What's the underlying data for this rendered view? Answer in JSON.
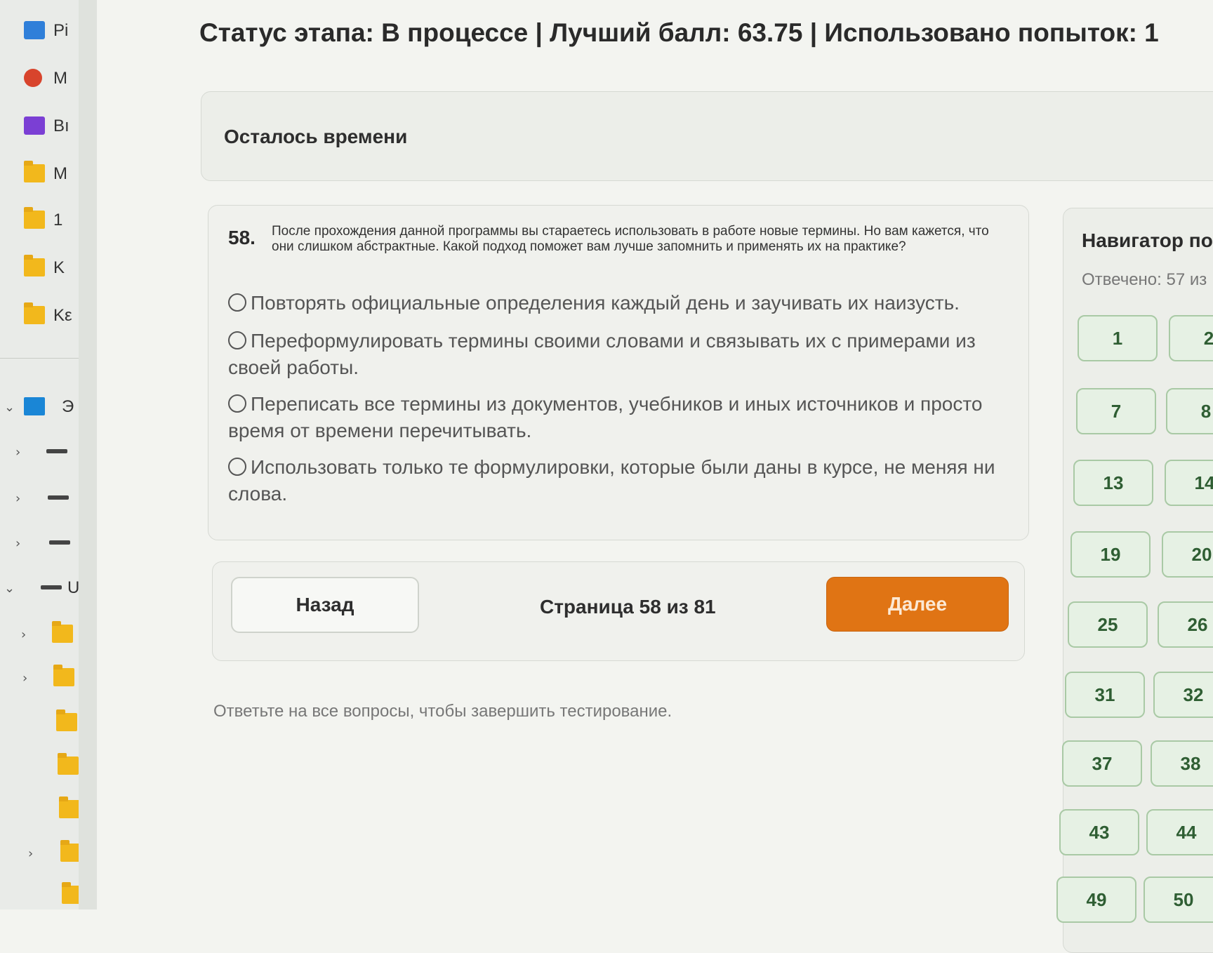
{
  "explorer": {
    "items": [
      {
        "label": "Pi",
        "icon": "pictures-icon"
      },
      {
        "label": "M",
        "icon": "music-icon"
      },
      {
        "label": "Bı",
        "icon": "video-icon"
      },
      {
        "label": "M",
        "icon": "folder-icon"
      },
      {
        "label": "1",
        "icon": "folder-icon"
      },
      {
        "label": "K",
        "icon": "folder-icon"
      },
      {
        "label": "Kε",
        "icon": "folder-icon"
      }
    ],
    "tree": [
      {
        "label": "Э",
        "icon": "pc-icon"
      },
      {
        "label": "",
        "icon": "network-icon"
      },
      {
        "label": "",
        "icon": "drive-icon"
      },
      {
        "label": "",
        "icon": "drive-icon"
      },
      {
        "label": "U",
        "icon": "drive-icon"
      }
    ]
  },
  "header": {
    "status_text": "Статус этапа: В процессе | Лучший балл: 63.75 | Использовано попыток: 1"
  },
  "timer": {
    "label": "Осталось времени"
  },
  "question": {
    "number": "58.",
    "text": "После прохождения данной программы вы стараетесь использовать в работе новые термины. Но вам кажется, что они слишком абстрактные. Какой подход поможет вам лучше запомнить и применять их на практике?",
    "options": [
      "Повторять официальные определения каждый день и заучивать их наизусть.",
      "Переформулировать термины своими словами и связывать их с примерами из своей работы.",
      "Переписать все термины из документов, учебников и иных источников и просто время от времени перечитывать.",
      "Использовать только те формулировки, которые были даны в курсе, не меняя ни слова."
    ]
  },
  "navigation": {
    "back_label": "Назад",
    "page_indicator": "Страница 58 из 81",
    "next_label": "Далее",
    "hint": "Ответьте на все вопросы, чтобы завершить тестирование."
  },
  "navigator": {
    "title": "Навигатор по",
    "answered": "Отвечено: 57 из",
    "buttons": [
      "1",
      "2",
      "7",
      "8",
      "13",
      "14",
      "19",
      "20",
      "25",
      "26",
      "31",
      "32",
      "37",
      "38",
      "43",
      "44",
      "49",
      "50"
    ]
  },
  "colors": {
    "accent": "#e07414",
    "answered_bg": "#e6f1e4",
    "answered_border": "#a9c9a5"
  }
}
